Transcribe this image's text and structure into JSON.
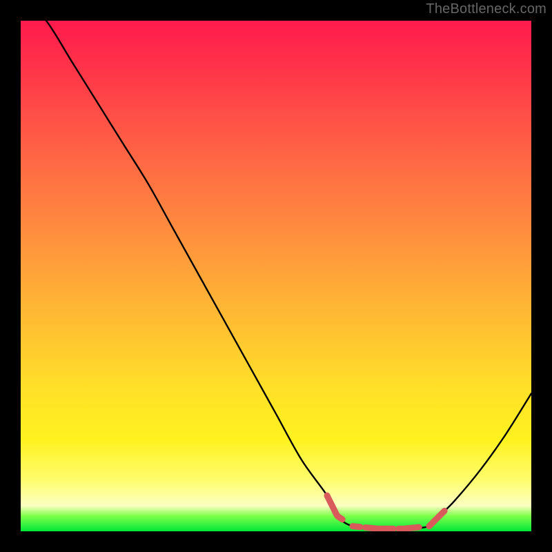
{
  "attribution": "TheBottleneck.com",
  "chart_data": {
    "type": "line",
    "title": "",
    "xlabel": "",
    "ylabel": "",
    "xlim": [
      0,
      100
    ],
    "ylim": [
      0,
      100
    ],
    "x": [
      0,
      5,
      10,
      15,
      20,
      25,
      30,
      35,
      40,
      45,
      50,
      55,
      60,
      62,
      65,
      70,
      75,
      80,
      82,
      85,
      90,
      95,
      100
    ],
    "values": [
      105,
      100,
      92,
      84,
      76,
      68,
      59,
      50,
      41,
      32,
      23,
      14,
      7,
      3,
      1,
      0.5,
      0.5,
      1,
      3,
      6,
      12,
      19,
      27
    ],
    "marker_segments": [
      {
        "x0": 60,
        "x1": 63
      },
      {
        "x0": 65,
        "x1": 66.5
      },
      {
        "x0": 67.5,
        "x1": 73
      },
      {
        "x0": 74,
        "x1": 78
      },
      {
        "x0": 80,
        "x1": 83
      }
    ],
    "colors": {
      "curve": "#000000",
      "markers": "#d85a5a",
      "gradient_top": "#ff1a4d",
      "gradient_mid": "#ffe028",
      "gradient_bottom": "#00e838"
    }
  }
}
